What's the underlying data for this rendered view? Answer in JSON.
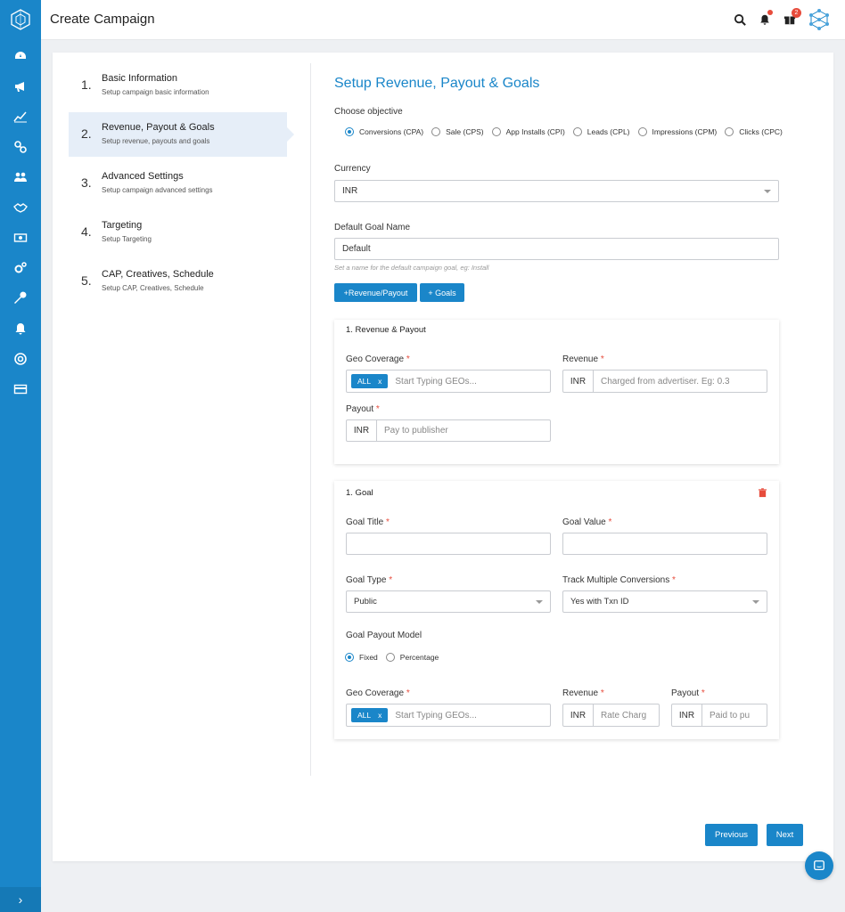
{
  "app": {
    "title": "Create Campaign"
  },
  "topbar": {
    "gift_badge": "2"
  },
  "sidebar": {
    "icons": [
      "dashboard-icon",
      "megaphone-icon",
      "chart-icon",
      "link-icon",
      "users-icon",
      "handshake-icon",
      "money-icon",
      "gears-icon",
      "wrench-icon",
      "bell-icon",
      "lifebuoy-icon",
      "card-icon"
    ],
    "collapse_label": "›"
  },
  "steps": [
    {
      "num": "1.",
      "title": "Basic Information",
      "subtitle": "Setup campaign basic information"
    },
    {
      "num": "2.",
      "title": "Revenue, Payout & Goals",
      "subtitle": "Setup revenue, payouts and goals"
    },
    {
      "num": "3.",
      "title": "Advanced Settings",
      "subtitle": "Setup campaign advanced settings"
    },
    {
      "num": "4.",
      "title": "Targeting",
      "subtitle": "Setup Targeting"
    },
    {
      "num": "5.",
      "title": "CAP, Creatives, Schedule",
      "subtitle": "Setup CAP, Creatives, Schedule"
    }
  ],
  "form": {
    "heading": "Setup Revenue, Payout & Goals",
    "objective_label": "Choose objective",
    "objectives": [
      "Conversions (CPA)",
      "Sale (CPS)",
      "App Installs (CPI)",
      "Leads (CPL)",
      "Impressions (CPM)",
      "Clicks (CPC)"
    ],
    "currency_label": "Currency",
    "currency_value": "INR",
    "default_goal_label": "Default Goal Name",
    "default_goal_value": "Default",
    "default_goal_hint": "Set a name for the default campaign goal, eg: Install",
    "add_revenue_btn": "+Revenue/Payout",
    "add_goals_btn": "+ Goals"
  },
  "revenue_card": {
    "title": "1. Revenue & Payout",
    "geo_label": "Geo Coverage",
    "geo_chip": "ALL",
    "chip_x": "x",
    "geo_placeholder": "Start Typing GEOs...",
    "revenue_label": "Revenue",
    "currency": "INR",
    "revenue_placeholder": "Charged from advertiser. Eg: 0.3",
    "payout_label": "Payout",
    "payout_placeholder": "Pay to publisher",
    "required_mark": "*"
  },
  "goal_card": {
    "title": "1. Goal",
    "goal_title_label": "Goal Title",
    "goal_value_label": "Goal Value",
    "goal_type_label": "Goal Type",
    "goal_type_value": "Public",
    "track_label": "Track Multiple Conversions",
    "track_value": "Yes with Txn ID",
    "payout_model_label": "Goal Payout Model",
    "payout_models": [
      "Fixed",
      "Percentage"
    ],
    "geo_label": "Geo Coverage",
    "geo_chip": "ALL",
    "geo_placeholder": "Start Typing GEOs...",
    "revenue_label": "Revenue",
    "revenue_placeholder": "Rate Charg",
    "payout_label": "Payout",
    "payout_placeholder": "Paid to pu",
    "currency": "INR"
  },
  "nav": {
    "previous": "Previous",
    "next": "Next"
  },
  "colors": {
    "accent": "#1a86c9",
    "danger": "#e74c3c"
  }
}
